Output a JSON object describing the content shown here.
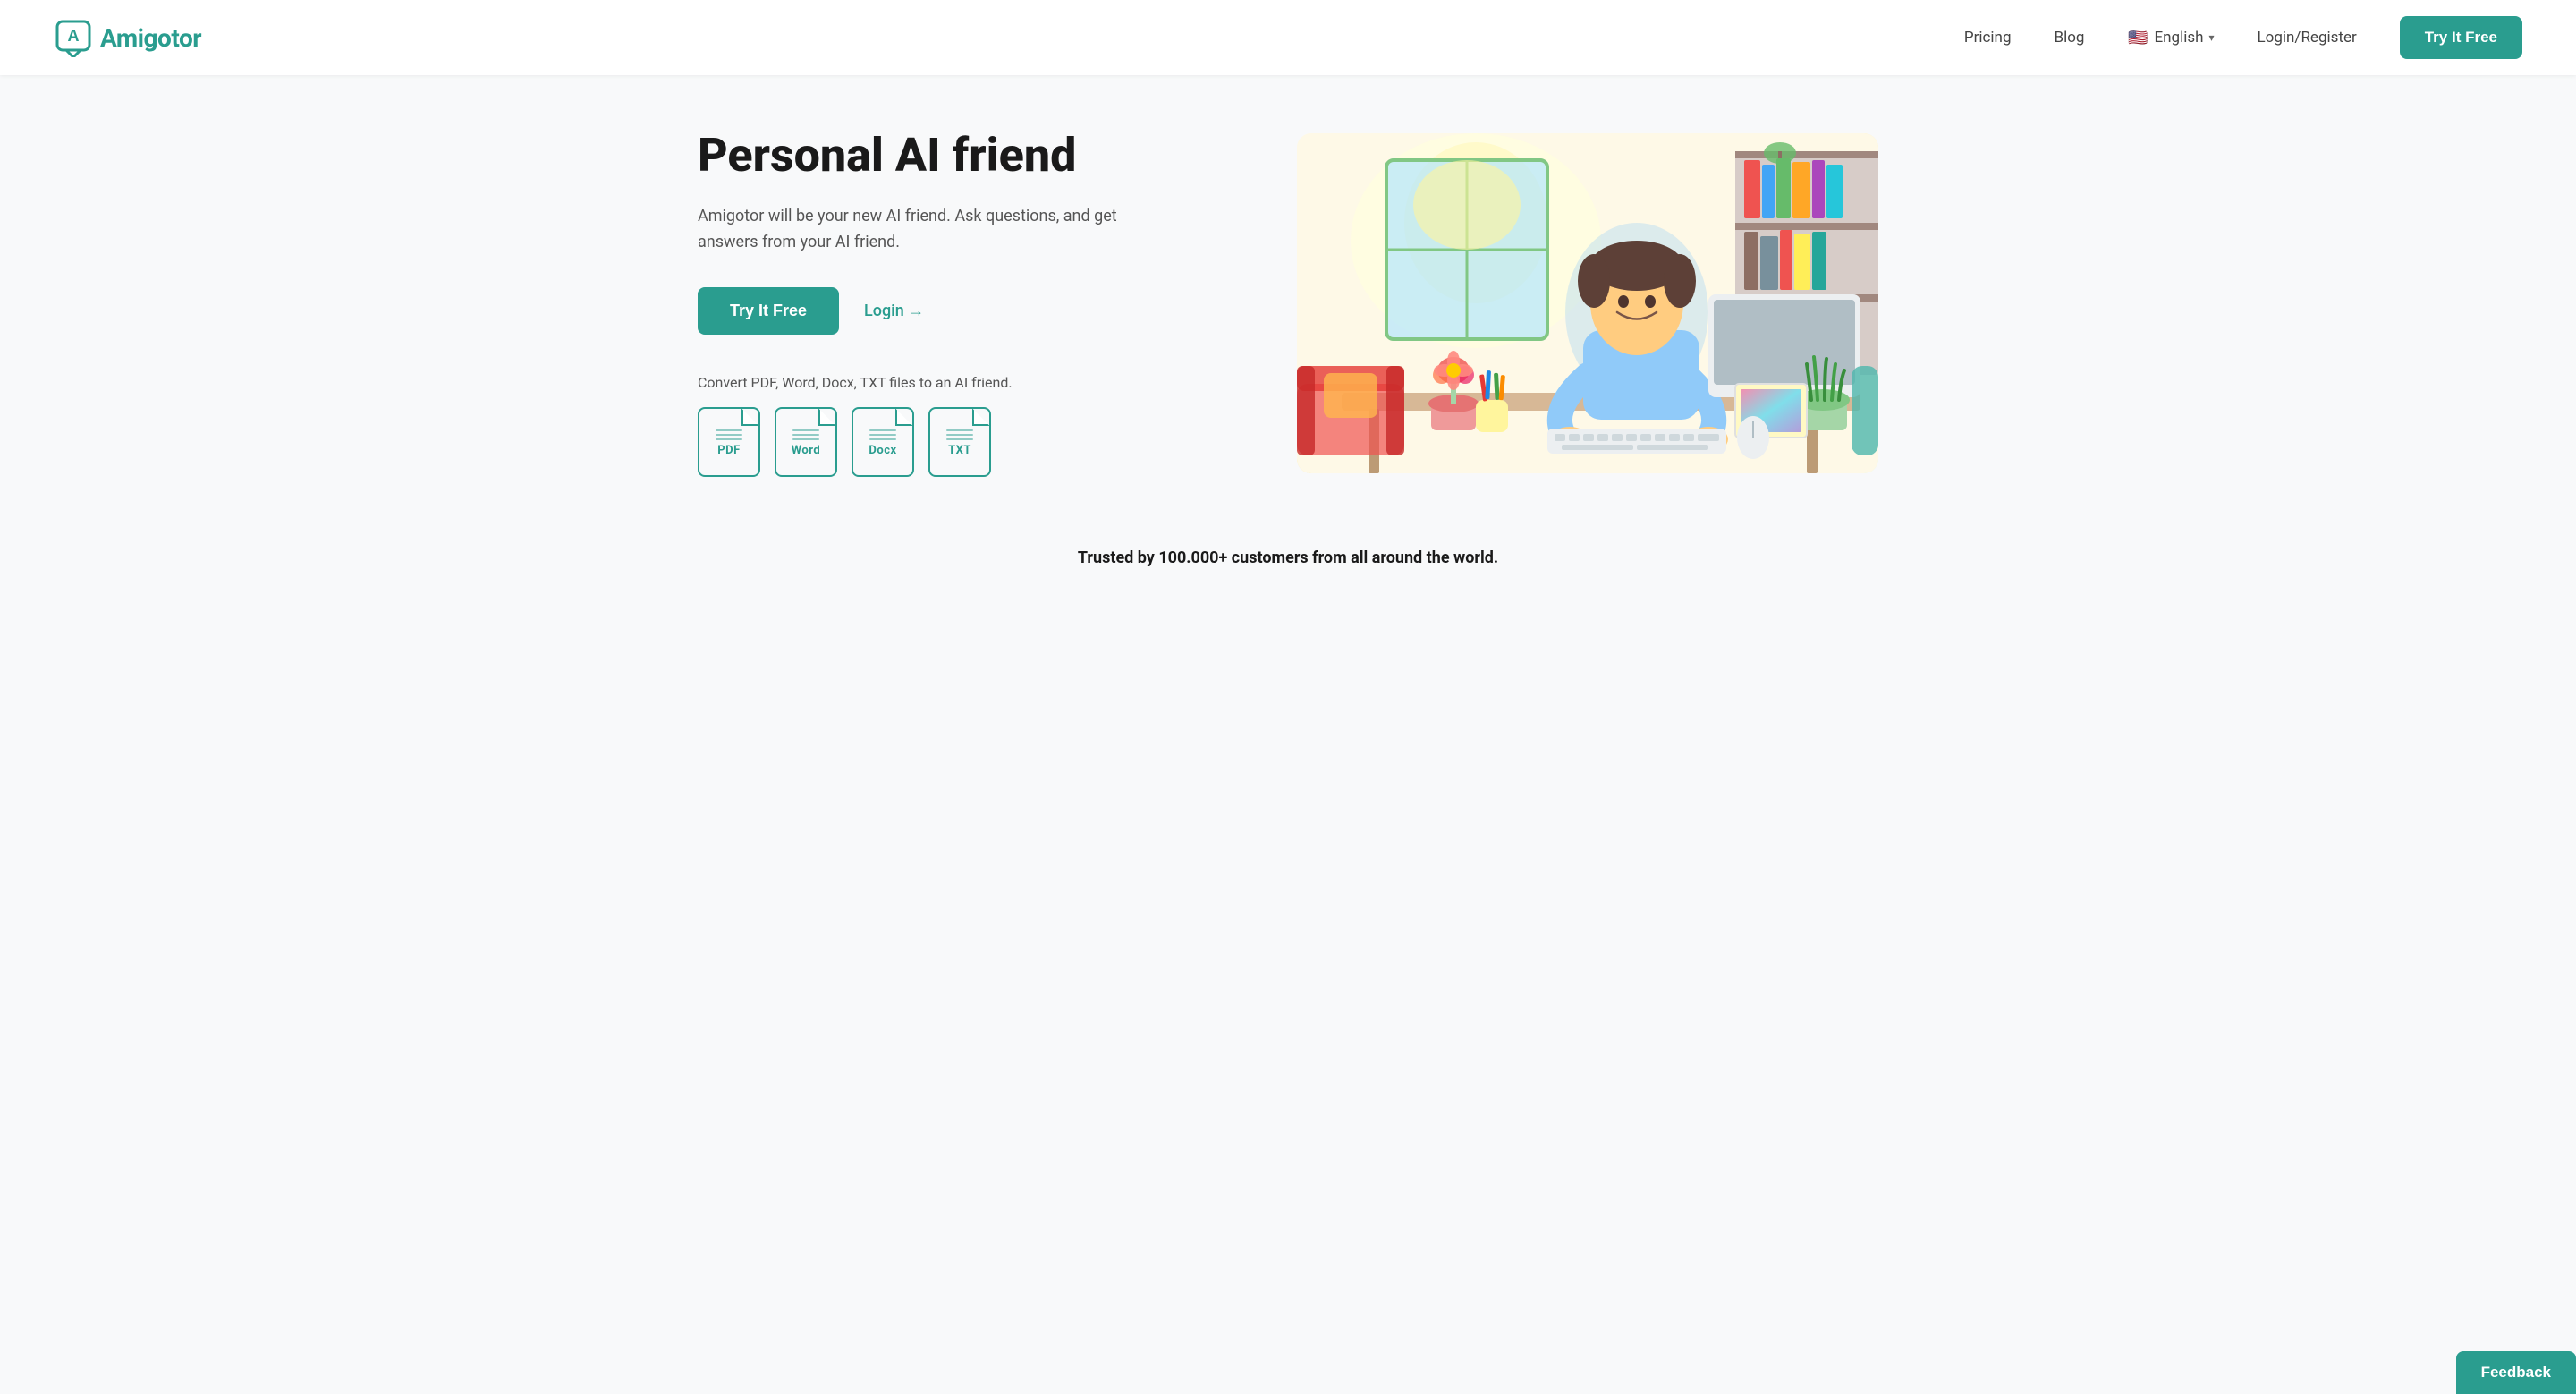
{
  "logo": {
    "text": "Amigotor",
    "icon_alt": "amigotor-logo"
  },
  "nav": {
    "pricing": "Pricing",
    "blog": "Blog",
    "language": "English",
    "login_register": "Login/Register",
    "try_it_free": "Try It Free"
  },
  "hero": {
    "title": "Personal AI friend",
    "subtitle": "Amigotor will be your new AI friend. Ask questions, and get answers from your AI friend.",
    "try_button": "Try It Free",
    "login_link": "Login →",
    "convert_text": "Convert PDF, Word, Docx, TXT files to an AI friend.",
    "file_types": [
      "PDF",
      "Word",
      "Docx",
      "TXT"
    ]
  },
  "trusted": {
    "text": "Trusted by 100.000+ customers from all around the world."
  },
  "feedback": {
    "label": "Feedback"
  },
  "colors": {
    "primary": "#2a9d8f",
    "primary_dark": "#22877a",
    "text_dark": "#1a1a1a",
    "text_medium": "#555555",
    "bg_light": "#f8f9fa"
  }
}
